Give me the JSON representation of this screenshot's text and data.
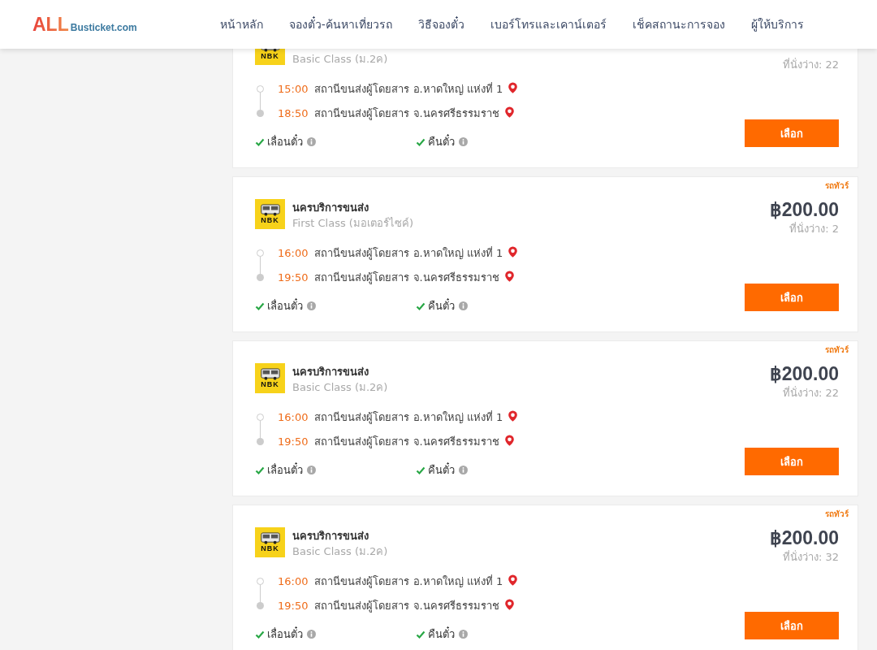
{
  "header": {
    "logo": {
      "main": "ALL",
      "sub": "Busticket.com"
    },
    "nav": [
      {
        "label": "หน้าหลัก"
      },
      {
        "label": "จองตั๋ว-ค้นหาเที่ยวรถ"
      },
      {
        "label": "วิธีจองตั๋ว"
      },
      {
        "label": "เบอร์โทรและเคาน์เตอร์"
      },
      {
        "label": "เช็คสถานะการจอง"
      },
      {
        "label": "ผู้ให้บริการ"
      }
    ]
  },
  "trips": [
    {
      "logo_text": "NBK",
      "bus_class": "Basic Class (ม.2ค)",
      "seats": "ที่นั่งว่าง: 22",
      "stops": [
        {
          "time": "15:00",
          "station": "สถานีขนส่งผู้โดยสาร อ.หาดใหญ่ แห่งที่ 1"
        },
        {
          "time": "18:50",
          "station": "สถานีขนส่งผู้โดยสาร จ.นครศรีธรรมราช"
        }
      ],
      "features": [
        {
          "label": "เลื่อนตั๋ว",
          "checked": true
        },
        {
          "label": "คืนตั๋ว",
          "checked": true
        }
      ],
      "button": "เลือก"
    },
    {
      "tag": "รถทัวร์",
      "logo_text": "NBK",
      "operator": "นครบริการขนส่ง",
      "bus_class": "First Class (มอเตอร์ไซค์)",
      "price": "฿200.00",
      "seats": "ที่นั่งว่าง: 2",
      "stops": [
        {
          "time": "16:00",
          "station": "สถานีขนส่งผู้โดยสาร อ.หาดใหญ่ แห่งที่ 1"
        },
        {
          "time": "19:50",
          "station": "สถานีขนส่งผู้โดยสาร จ.นครศรีธรรมราช"
        }
      ],
      "features": [
        {
          "label": "เลื่อนตั๋ว",
          "checked": true
        },
        {
          "label": "คืนตั๋ว",
          "checked": true
        }
      ],
      "button": "เลือก"
    },
    {
      "tag": "รถทัวร์",
      "logo_text": "NBK",
      "operator": "นครบริการขนส่ง",
      "bus_class": "Basic Class (ม.2ค)",
      "price": "฿200.00",
      "seats": "ที่นั่งว่าง: 22",
      "stops": [
        {
          "time": "16:00",
          "station": "สถานีขนส่งผู้โดยสาร อ.หาดใหญ่ แห่งที่ 1"
        },
        {
          "time": "19:50",
          "station": "สถานีขนส่งผู้โดยสาร จ.นครศรีธรรมราช"
        }
      ],
      "features": [
        {
          "label": "เลื่อนตั๋ว",
          "checked": true
        },
        {
          "label": "คืนตั๋ว",
          "checked": true
        }
      ],
      "button": "เลือก"
    },
    {
      "tag": "รถทัวร์",
      "logo_text": "NBK",
      "operator": "นครบริการขนส่ง",
      "bus_class": "Basic Class (ม.2ค)",
      "price": "฿200.00",
      "seats": "ที่นั่งว่าง: 32",
      "stops": [
        {
          "time": "16:00",
          "station": "สถานีขนส่งผู้โดยสาร อ.หาดใหญ่ แห่งที่ 1"
        },
        {
          "time": "19:50",
          "station": "สถานีขนส่งผู้โดยสาร จ.นครศรีธรรมราช"
        }
      ],
      "features": [
        {
          "label": "เลื่อนตั๋ว",
          "checked": true
        },
        {
          "label": "คืนตั๋ว",
          "checked": true
        }
      ],
      "button": "เลือก"
    }
  ]
}
